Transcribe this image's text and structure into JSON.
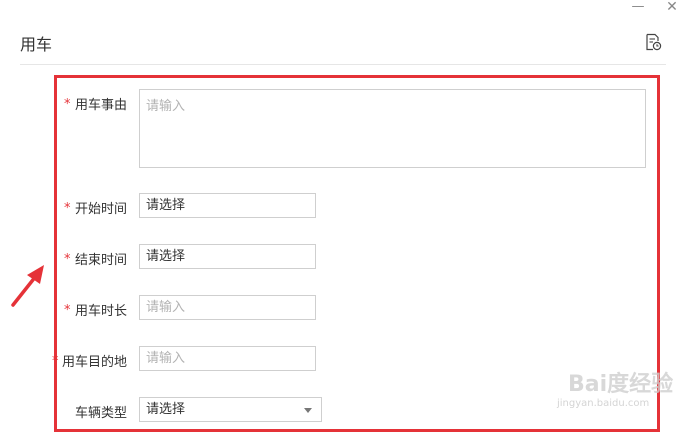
{
  "window": {
    "minimize_glyph": "—",
    "close_glyph": "✕"
  },
  "dialog": {
    "title": "用车",
    "header_icon": "doc-clock-icon"
  },
  "form": {
    "required_mark": "*",
    "fields": {
      "reason": {
        "label": "用车事由",
        "required": true,
        "placeholder": "请输入",
        "value": ""
      },
      "start_time": {
        "label": "开始时间",
        "required": true,
        "value": "请选择"
      },
      "end_time": {
        "label": "结束时间",
        "required": true,
        "value": "请选择"
      },
      "duration": {
        "label": "用车时长",
        "required": true,
        "placeholder": "请输入",
        "value": ""
      },
      "destination": {
        "label": "用车目的地",
        "required": true,
        "placeholder": "请输入",
        "value": ""
      },
      "vehicle_type": {
        "label": "车辆类型",
        "required": false,
        "value": "请选择"
      }
    }
  },
  "annotation": {
    "color": "#e53238"
  },
  "watermark": {
    "text": "Bai度经验",
    "sub": "jingyan.baidu.com"
  },
  "colors": {
    "accent_red": "#e53238",
    "border": "#cfcfcf",
    "placeholder": "#b3b3b3"
  }
}
